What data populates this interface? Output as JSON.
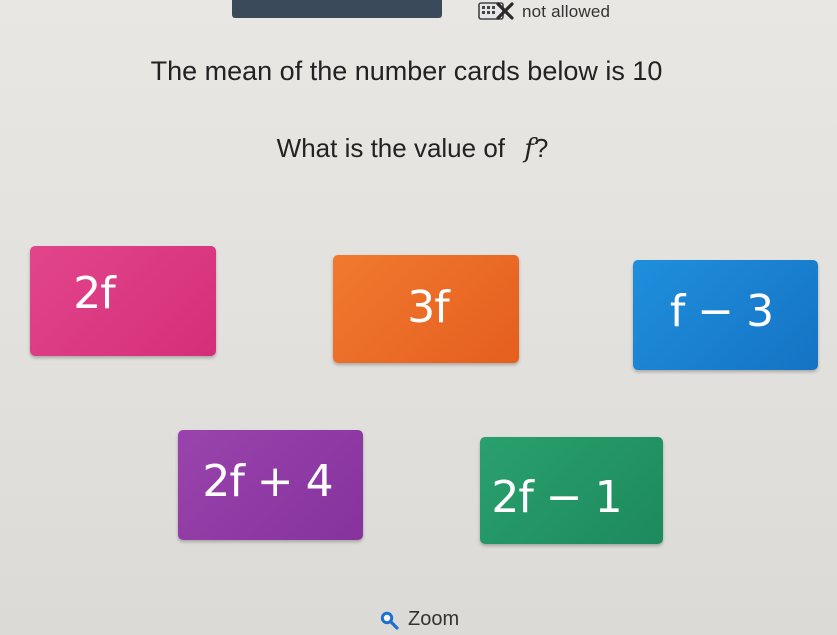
{
  "calculator": {
    "icon": "calculator-crossed-icon",
    "status_text": "not allowed",
    "cross_color": "#2a2a2a"
  },
  "question": {
    "line1": "The mean of the number cards below is 10",
    "line2_prefix": "What is the value of ",
    "line2_variable": "f",
    "line2_suffix": "?"
  },
  "cards": [
    {
      "label": "2f",
      "color": "#d83a80"
    },
    {
      "label": "3f",
      "color": "#ea6a26"
    },
    {
      "label": "f − 3",
      "color": "#1a82d0"
    },
    {
      "label": "2f + 4",
      "color": "#903ba5"
    },
    {
      "label": "2f − 1",
      "color": "#239465"
    }
  ],
  "zoom": {
    "icon": "magnifier-icon",
    "label": "Zoom",
    "icon_color": "#1f6fd1"
  }
}
